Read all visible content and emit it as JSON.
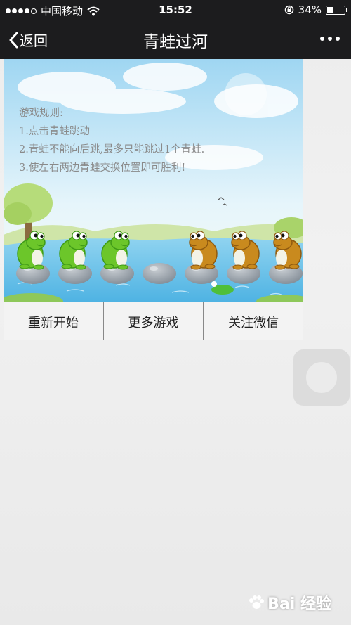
{
  "status_bar": {
    "carrier": "中国移动",
    "time": "15:52",
    "battery_text": "34%",
    "battery_level": 0.34
  },
  "nav": {
    "back_label": "返回",
    "title": "青蛙过河",
    "more_icon": "more-dots-icon"
  },
  "game": {
    "rules": {
      "heading": "游戏规则:",
      "items": [
        "1.点击青蛙跳动",
        "2.青蛙不能向后跳,最多只能跳过1个青蛙.",
        "3.使左右两边青蛙交换位置即可胜利!"
      ]
    },
    "stones": [
      {
        "frog": "green"
      },
      {
        "frog": "green"
      },
      {
        "frog": "green"
      },
      {
        "frog": null
      },
      {
        "frog": "brown"
      },
      {
        "frog": "brown"
      },
      {
        "frog": "brown"
      }
    ],
    "colors": {
      "green_frog": "#6cc62a",
      "brown_frog": "#c98a1e",
      "water": "#6cc4ec",
      "sky": "#bfe6f7"
    },
    "buttons": {
      "restart": "重新开始",
      "more_games": "更多游戏",
      "follow_wechat": "关注微信"
    }
  },
  "watermark": {
    "text": "Bai 经验"
  }
}
